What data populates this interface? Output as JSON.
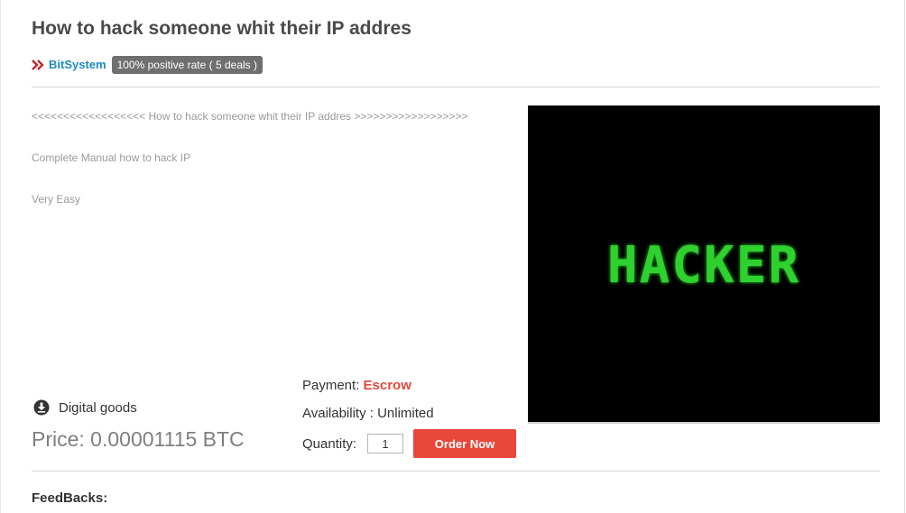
{
  "listing": {
    "title": "How to hack someone whit their IP addres",
    "seller_name": "BitSystem",
    "seller_rating": "100% positive rate ( 5 deals )",
    "description_lines": [
      "<<<<<<<<<<<<<<<<<< How to hack someone whit their IP addres >>>>>>>>>>>>>>>>>>",
      "Complete Manual how to hack IP",
      "Very Easy"
    ],
    "image_text": "HACKER",
    "goods_type": "Digital goods",
    "price": "Price: 0.00001115 BTC",
    "payment_label": "Payment: ",
    "payment_value": "Escrow",
    "availability": "Availability : Unlimited",
    "quantity_label": "Quantity:",
    "quantity_value": "1",
    "order_button": "Order Now",
    "feedbacks_heading": "FeedBacks:"
  },
  "colors": {
    "accent_red": "#e8473b",
    "link_blue": "#1e8bbf",
    "badge_gray": "#6f6f6f",
    "hacker_green": "#2fd12f"
  },
  "icons": {
    "seller_marker": "double-chevron-right-icon",
    "goods_type": "download-circle-icon"
  }
}
